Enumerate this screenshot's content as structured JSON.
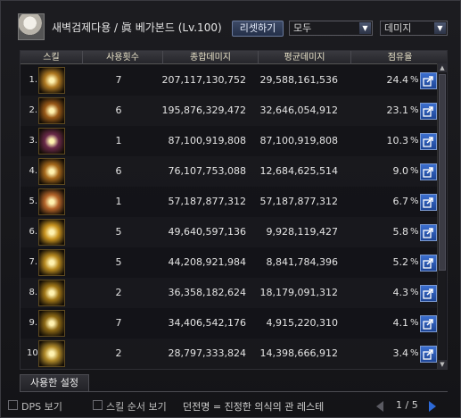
{
  "header": {
    "title": "새벽검제다용 / 眞 베가본드 (Lv.100)",
    "reset_label": "리셋하기",
    "filter_select": "모두",
    "metric_select": "데미지"
  },
  "table": {
    "columns": [
      "스킬",
      "사용횟수",
      "종합데미지",
      "평균데미지",
      "점유율"
    ],
    "rows": [
      {
        "rank": "1.",
        "count": "7",
        "total": "207,117,130,752",
        "avg": "29,588,161,536",
        "share": "24.4",
        "icon_color": "#b07a22"
      },
      {
        "rank": "2.",
        "count": "6",
        "total": "195,876,329,472",
        "avg": "32,646,054,912",
        "share": "23.1",
        "icon_color": "#9a5a18"
      },
      {
        "rank": "3.",
        "count": "1",
        "total": "87,100,919,808",
        "avg": "87,100,919,808",
        "share": "10.3",
        "icon_color": "#6a2a4a"
      },
      {
        "rank": "4.",
        "count": "6",
        "total": "76,107,753,088",
        "avg": "12,684,625,514",
        "share": "9.0",
        "icon_color": "#a86a1c"
      },
      {
        "rank": "5.",
        "count": "1",
        "total": "57,187,877,312",
        "avg": "57,187,877,312",
        "share": "6.7",
        "icon_color": "#b5652a"
      },
      {
        "rank": "6.",
        "count": "5",
        "total": "49,640,597,136",
        "avg": "9,928,119,427",
        "share": "5.8",
        "icon_color": "#c99420"
      },
      {
        "rank": "7.",
        "count": "5",
        "total": "44,208,921,984",
        "avg": "8,841,784,396",
        "share": "5.2",
        "icon_color": "#b88a20"
      },
      {
        "rank": "8.",
        "count": "2",
        "total": "36,358,182,624",
        "avg": "18,179,091,312",
        "share": "4.3",
        "icon_color": "#a27818"
      },
      {
        "rank": "9.",
        "count": "7",
        "total": "34,406,542,176",
        "avg": "4,915,220,310",
        "share": "4.1",
        "icon_color": "#8e6a16"
      },
      {
        "rank": "10.",
        "count": "2",
        "total": "28,797,333,824",
        "avg": "14,398,666,912",
        "share": "3.4",
        "icon_color": "#b08a2a"
      }
    ],
    "pct_symbol": "%"
  },
  "bottom_tab": "사용한 설정",
  "status": {
    "dps_label": "DPS 보기",
    "order_label": "스킬 순서 보기",
    "dungeon_text": "던전명 = 진정한 의식의 관 레스테",
    "page": "1 / 5"
  }
}
